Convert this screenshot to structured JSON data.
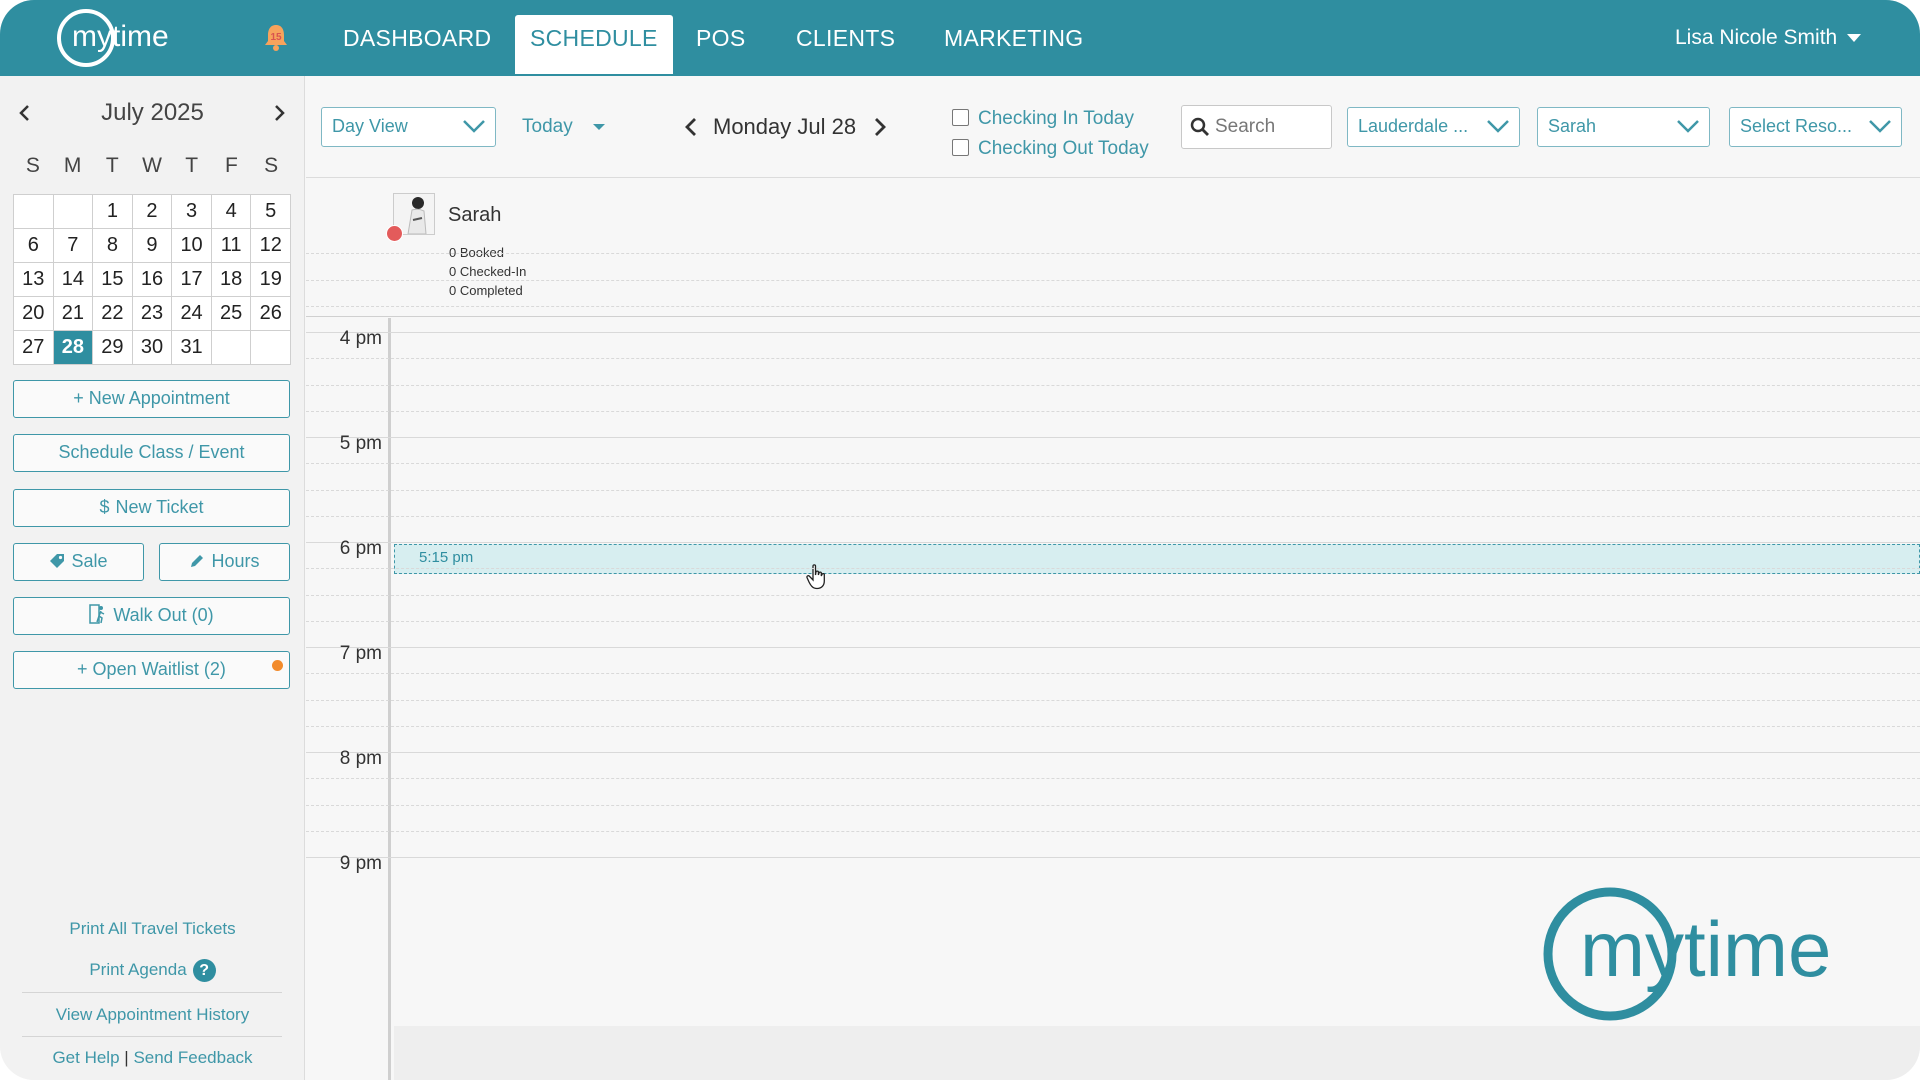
{
  "brand": {
    "logo_text": "mytime",
    "accent": "#2f8ea0",
    "alert_color": "#f28b2c",
    "status_red": "#e35b5b"
  },
  "topbar": {
    "notifications_icon": "bell-icon",
    "notification_count": "15",
    "nav": [
      {
        "label": "DASHBOARD",
        "active": false
      },
      {
        "label": "SCHEDULE",
        "active": true
      },
      {
        "label": "POS",
        "active": false
      },
      {
        "label": "CLIENTS",
        "active": false
      },
      {
        "label": "MARKETING",
        "active": false
      }
    ],
    "user_name": "Lisa Nicole Smith"
  },
  "calendar": {
    "month_label": "July 2025",
    "weekdays": [
      "S",
      "M",
      "T",
      "W",
      "T",
      "F",
      "S"
    ],
    "days": [
      "",
      "",
      "1",
      "2",
      "3",
      "4",
      "5",
      "6",
      "7",
      "8",
      "9",
      "10",
      "11",
      "12",
      "13",
      "14",
      "15",
      "16",
      "17",
      "18",
      "19",
      "20",
      "21",
      "22",
      "23",
      "24",
      "25",
      "26",
      "27",
      "28",
      "29",
      "30",
      "31",
      "",
      ""
    ],
    "selected_day": "28"
  },
  "sidebar": {
    "new_appointment": "+ New Appointment",
    "schedule_class": "Schedule Class / Event",
    "new_ticket_glyph": "$",
    "new_ticket": "New Ticket",
    "sale": "Sale",
    "hours": "Hours",
    "walk_out": "Walk Out (0)",
    "open_waitlist": "+ Open Waitlist (2)",
    "print_travel": "Print All Travel Tickets",
    "print_agenda": "Print Agenda",
    "help_glyph": "?",
    "view_history": "View Appointment History",
    "get_help": "Get Help",
    "separator": "|",
    "send_feedback": "Send Feedback"
  },
  "toolbar": {
    "view_select": "Day View",
    "today": "Today",
    "current_date": "Monday Jul 28",
    "checking_in": "Checking In Today",
    "checking_out": "Checking Out Today",
    "search_placeholder": "Search",
    "location_select": "Lauderdale ...",
    "staff_select": "Sarah",
    "resource_select": "Select Reso..."
  },
  "resource": {
    "name": "Sarah",
    "booked": "0 Booked",
    "checked_in": "0 Checked-In",
    "completed": "0 Completed"
  },
  "schedule": {
    "hours": [
      "4 pm",
      "5 pm",
      "6 pm",
      "7 pm",
      "8 pm",
      "9 pm"
    ],
    "hover_slot": "5:15 pm"
  }
}
